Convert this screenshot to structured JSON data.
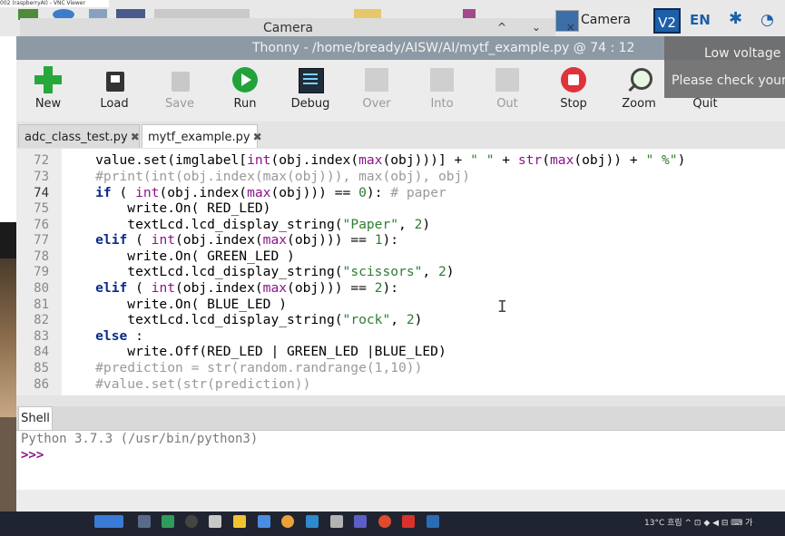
{
  "background": {
    "vnc_title": "002 (raspberryAI) - VNC Viewer"
  },
  "pi_taskbar": {
    "camera_window_label": "Camera",
    "vnc_icon_label": "V2",
    "language": "EN"
  },
  "camera_window": {
    "title": "Camera",
    "controls": "^ ⌄ ×"
  },
  "thonny": {
    "title": "Thonny  -  /home/bready/AISW/AI/mytf_example.py  @  74 : 12",
    "toolbar": [
      {
        "label": "New",
        "enabled": true
      },
      {
        "label": "Load",
        "enabled": true
      },
      {
        "label": "Save",
        "enabled": false
      },
      {
        "label": "Run",
        "enabled": true
      },
      {
        "label": "Debug",
        "enabled": true
      },
      {
        "label": "Over",
        "enabled": false
      },
      {
        "label": "Into",
        "enabled": false
      },
      {
        "label": "Out",
        "enabled": false
      },
      {
        "label": "Stop",
        "enabled": true
      },
      {
        "label": "Zoom",
        "enabled": true
      },
      {
        "label": "Quit",
        "enabled": true
      }
    ],
    "tabs": [
      {
        "label": "adc_class_test.py",
        "close": "✖"
      },
      {
        "label": "mytf_example.py",
        "close": "✖"
      }
    ],
    "line_numbers": [
      "72",
      "73",
      "74",
      "75",
      "76",
      "77",
      "78",
      "79",
      "80",
      "81",
      "82",
      "83",
      "84",
      "85",
      "86"
    ],
    "shell": {
      "tab_label": "Shell",
      "version": "Python 3.7.3 (/usr/bin/python3)",
      "prompt": ">>>"
    }
  },
  "notification": {
    "line1": "Low voltage w",
    "line2": "Please check your p"
  },
  "windows_taskbar": {
    "tray": "13°C 흐림   ^  ⊡  ◆  ◀  ⊟  ⌨  가"
  }
}
